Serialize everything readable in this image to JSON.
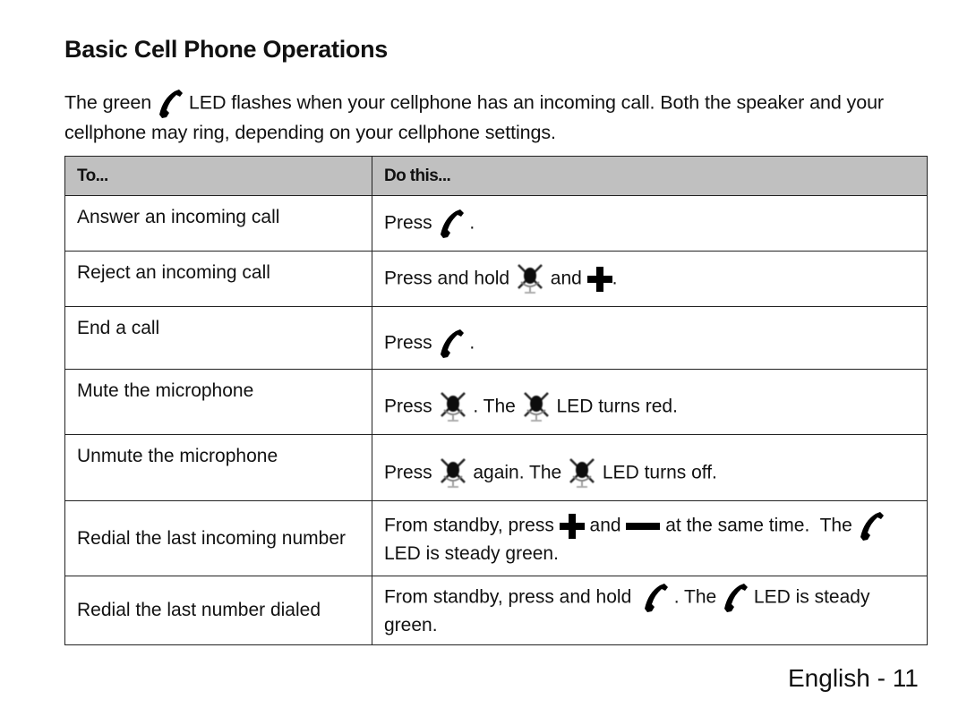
{
  "page": {
    "title": "Basic Cell Phone Operations",
    "intro": {
      "part1": "The green ",
      "icon": "phone-handset-icon",
      "part2": " LED flashes when your cellphone has an incoming call.  Both the speaker and your cellphone may ring, depending on your cellphone settings."
    },
    "footer": "English - 11"
  },
  "table": {
    "headers": [
      "To...",
      "Do this..."
    ],
    "rows": [
      {
        "to": "Answer an incoming call",
        "do": [
          {
            "text": "Press "
          },
          {
            "icon": "phone-handset-icon"
          },
          {
            "text": " ."
          }
        ]
      },
      {
        "to": "Reject an incoming call",
        "do": [
          {
            "text": "Press and hold "
          },
          {
            "icon": "mute-mic-icon"
          },
          {
            "text": " and "
          },
          {
            "icon": "plus-icon"
          },
          {
            "text": "."
          }
        ]
      },
      {
        "to": "End a call",
        "do": [
          {
            "text": "Press "
          },
          {
            "icon": "phone-handset-icon"
          },
          {
            "text": " ."
          }
        ]
      },
      {
        "to": "Mute the microphone",
        "do": [
          {
            "text": "Press "
          },
          {
            "icon": "mute-mic-icon"
          },
          {
            "text": " . The "
          },
          {
            "icon": "mute-mic-icon"
          },
          {
            "text": " LED turns red."
          }
        ]
      },
      {
        "to": "Unmute the microphone",
        "do": [
          {
            "text": "Press "
          },
          {
            "icon": "mute-mic-icon"
          },
          {
            "text": " again. The "
          },
          {
            "icon": "mute-mic-icon"
          },
          {
            "text": " LED turns off."
          }
        ]
      },
      {
        "to": "Redial the last incoming number",
        "do": [
          {
            "text": "From standby, press "
          },
          {
            "icon": "plus-icon"
          },
          {
            "text": " and "
          },
          {
            "icon": "minus-icon"
          },
          {
            "text": " at the same time.  The "
          },
          {
            "icon": "phone-handset-icon"
          },
          {
            "text": " LED is steady green."
          }
        ]
      },
      {
        "to": "Redial the last number dialed",
        "do": [
          {
            "text": "From standby, press and hold  "
          },
          {
            "icon": "phone-handset-icon"
          },
          {
            "text": " . The "
          },
          {
            "icon": "phone-handset-icon"
          },
          {
            "text": " LED is steady green."
          }
        ]
      }
    ]
  },
  "colors": {
    "header_bg": "#c0c0c0",
    "border": "#222222",
    "text": "#111111"
  }
}
